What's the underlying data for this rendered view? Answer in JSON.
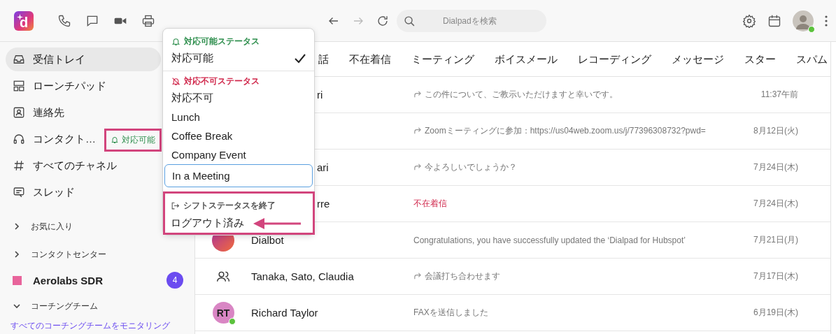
{
  "app_logo": {
    "text": "d"
  },
  "search": {
    "placeholder": "Dialpadを検索"
  },
  "sidebar": {
    "items": [
      {
        "label": "受信トレイ",
        "selected": true
      },
      {
        "label": "ローンチパッド",
        "selected": false
      },
      {
        "label": "連絡先",
        "selected": false
      },
      {
        "label": "コンタクト…",
        "selected": false,
        "status": {
          "label": "対応可能",
          "highlighted": true
        }
      },
      {
        "label": "すべてのチャネル",
        "selected": false
      },
      {
        "label": "スレッド",
        "selected": false
      }
    ],
    "sections": [
      {
        "title": "お気に入り",
        "expanded": false
      },
      {
        "title": "コンタクトセンター",
        "expanded": false,
        "items": [
          {
            "label": "Aerolabs SDR",
            "color": "#e8649b",
            "count": "4"
          }
        ]
      },
      {
        "title": "コーチングチーム",
        "expanded": true,
        "link": "すべてのコーチングチームをモニタリング"
      }
    ]
  },
  "tabs": [
    {
      "label": "話",
      "selected": false
    },
    {
      "label": "不在着信",
      "selected": false
    },
    {
      "label": "ミーティング",
      "selected": false
    },
    {
      "label": "ボイスメール",
      "selected": false
    },
    {
      "label": "レコーディング",
      "selected": false
    },
    {
      "label": "メッセージ",
      "selected": false
    },
    {
      "label": "スター",
      "selected": false
    },
    {
      "label": "スパム",
      "selected": false
    }
  ],
  "rows": [
    {
      "name": "ri",
      "preview": {
        "kind": "reply",
        "text": "この件について、ご教示いただけますと幸いです。"
      },
      "time": "11:37午前"
    },
    {
      "preview": {
        "kind": "reply",
        "text": "Zoomミーティングに参加：https://us04web.zoom.us/j/77396308732?pwd="
      },
      "time": "8月12日(火)"
    },
    {
      "name": "ari",
      "preview": {
        "kind": "reply",
        "text": "今よろしいでしょうか？"
      },
      "time": "7月24日(木)"
    },
    {
      "name": "rre",
      "preview": {
        "kind": "missed",
        "text": "不在着信"
      },
      "time": "7月24日(木)"
    },
    {
      "avatar": {
        "kind": "bot"
      },
      "name": "Dialbot",
      "preview": {
        "kind": "plain",
        "text": "Congratulations, you have successfully updated the ‘Dialpad for Hubspot’"
      },
      "time": "7月21日(月)"
    },
    {
      "avatar": {
        "kind": "group"
      },
      "name": "Tanaka, Sato, Claudia",
      "preview": {
        "kind": "reply",
        "text": "会議打ち合わせます"
      },
      "time": "7月17日(木)"
    },
    {
      "avatar": {
        "kind": "initials",
        "initials": "RT",
        "online": true
      },
      "name": "Richard Taylor",
      "preview": {
        "kind": "plain",
        "text": "FAXを送信しました"
      },
      "time": "6月19日(木)"
    }
  ],
  "status_menu": {
    "sections": [
      {
        "kind": "available",
        "title": "対応可能ステータス",
        "items": [
          {
            "label": "対応可能",
            "selected": true
          }
        ]
      },
      {
        "kind": "unavailable",
        "title": "対応不可ステータス",
        "items": [
          {
            "label": "対応不可",
            "selected": false
          },
          {
            "label": "Lunch",
            "selected": false
          },
          {
            "label": "Coffee Break",
            "selected": false
          },
          {
            "label": "Company Event",
            "selected": false
          },
          {
            "label": "In a Meeting",
            "selected": false,
            "focused": true
          }
        ]
      },
      {
        "kind": "end_shift",
        "title": "シフトステータスを終了",
        "highlighted": true,
        "items": [
          {
            "label": "ログアウト済み",
            "selected": false,
            "arrow": true
          }
        ]
      }
    ]
  }
}
